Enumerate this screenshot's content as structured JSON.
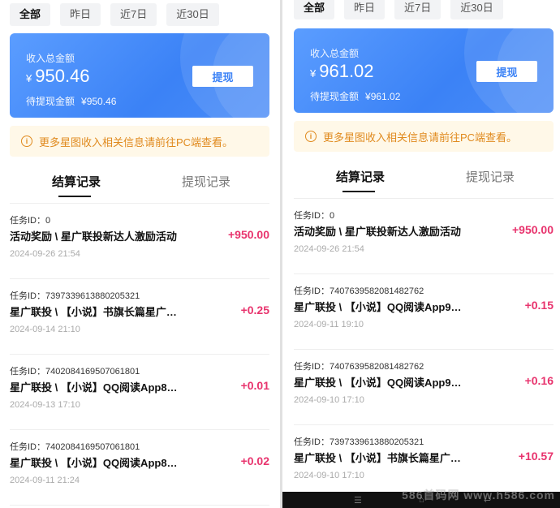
{
  "left": {
    "date_tabs": [
      "全部",
      "昨日",
      "近7日",
      "近30日"
    ],
    "card": {
      "label": "收入总金额",
      "currency": "¥",
      "amount": "950.46",
      "pending_label": "待提现金额",
      "pending_amount": "¥950.46",
      "button": "提现"
    },
    "notice": "更多星图收入相关信息请前往PC端查看。",
    "tabs": [
      "结算记录",
      "提现记录"
    ],
    "records": [
      {
        "id": "任务ID：0",
        "title": "活动奖励 \\ 星广联投新达人激励活动",
        "time": "2024-09-26 21:54",
        "amount": "+950.00"
      },
      {
        "id": "任务ID：7397339613880205321",
        "title": "星广联投 \\ 【小说】书旗长篇星广…",
        "time": "2024-09-14 21:10",
        "amount": "+0.25"
      },
      {
        "id": "任务ID：7402084169507061801",
        "title": "星广联投 \\ 【小说】QQ阅读App8…",
        "time": "2024-09-13 17:10",
        "amount": "+0.01"
      },
      {
        "id": "任务ID：7402084169507061801",
        "title": "星广联投 \\ 【小说】QQ阅读App8…",
        "time": "2024-09-11 21:24",
        "amount": "+0.02"
      }
    ]
  },
  "right": {
    "date_tabs": [
      "全部",
      "昨日",
      "近7日",
      "近30日"
    ],
    "card": {
      "label": "收入总金额",
      "currency": "¥",
      "amount": "961.02",
      "pending_label": "待提现金额",
      "pending_amount": "¥961.02",
      "button": "提现"
    },
    "notice": "更多星图收入相关信息请前往PC端查看。",
    "tabs": [
      "结算记录",
      "提现记录"
    ],
    "records": [
      {
        "id": "任务ID：0",
        "title": "活动奖励 \\ 星广联投新达人激励活动",
        "time": "2024-09-26 21:54",
        "amount": "+950.00"
      },
      {
        "id": "任务ID：7407639582081482762",
        "title": "星广联投 \\ 【小说】QQ阅读App9…",
        "time": "2024-09-11 19:10",
        "amount": "+0.15"
      },
      {
        "id": "任务ID：7407639582081482762",
        "title": "星广联投 \\ 【小说】QQ阅读App9…",
        "time": "2024-09-10 17:10",
        "amount": "+0.16"
      },
      {
        "id": "任务ID：7397339613880205321",
        "title": "星广联投 \\ 【小说】书旗长篇星广…",
        "time": "2024-09-10 17:10",
        "amount": "+10.57"
      }
    ],
    "watermark": "586首码网 www.h586.com"
  },
  "colors": {
    "accent": "#3b82f6",
    "amount": "#e8336d",
    "notice": "#e08a1e"
  }
}
